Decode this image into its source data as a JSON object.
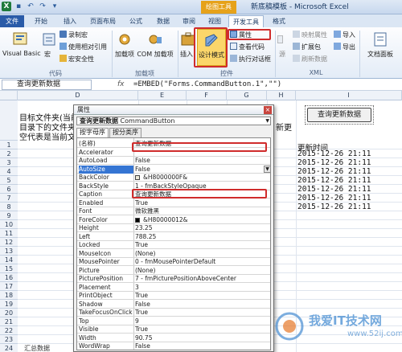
{
  "window": {
    "context_tab": "绘图工具",
    "title": "新底稿模板 - Microsoft Excel"
  },
  "tabs": [
    {
      "label": "文件"
    },
    {
      "label": "开始"
    },
    {
      "label": "插入"
    },
    {
      "label": "页面布局"
    },
    {
      "label": "公式"
    },
    {
      "label": "数据"
    },
    {
      "label": "审阅"
    },
    {
      "label": "视图"
    },
    {
      "label": "开发工具"
    },
    {
      "label": "格式"
    }
  ],
  "ribbon": {
    "code": {
      "visual_basic": "Visual Basic",
      "macro": "宏",
      "record_macro": "录制宏",
      "relative_ref": "使用相对引用",
      "macro_security": "宏安全性",
      "group_label": "代码"
    },
    "addins": {
      "addins": "加载项",
      "com_addins": "COM 加载项",
      "group_label": "加载项"
    },
    "controls": {
      "insert": "插入",
      "design_mode": "设计模式",
      "properties": "属性",
      "view_code": "查看代码",
      "run_dialog": "执行对话框",
      "group_label": "控件"
    },
    "xml": {
      "source": "源",
      "map_props": "映射属性",
      "expansion_packs": "扩展包",
      "refresh_data": "刷新数据",
      "import": "导入",
      "export": "导出",
      "group_label": "XML"
    },
    "modify": {
      "doc_panel": "文档面板"
    }
  },
  "formula_bar": {
    "name_box": "查询更新数据",
    "fx": "fx",
    "formula": "=EMBED(\"Forms.CommandButton.1\",\"\")"
  },
  "sheet": {
    "columns": [
      "D",
      "E",
      "F",
      "G",
      "H",
      "I"
    ],
    "rows": [
      "1",
      "2",
      "3",
      "4",
      "5",
      "6",
      "7",
      "8",
      "9",
      "10",
      "11",
      "12",
      "13",
      "14",
      "15",
      "16",
      "17",
      "18",
      "19",
      "20",
      "21",
      "22",
      "23",
      "24",
      "25"
    ],
    "text_lines": [
      "目标文件夹(当前",
      "目录下的文件夹",
      "空代表是当前文"
    ],
    "right_text": "新更",
    "header_update_time": "更新时间",
    "dates": [
      "2015-12-26 21:11",
      "2015-12-26 21:11",
      "2015-12-26 21:11",
      "2015-12-26 21:11",
      "2015-12-26 21:11",
      "2015-12-26 21:11",
      "2015-12-26 21:11"
    ],
    "button_label": "查询更新数据",
    "sheet_tab": "汇总数据"
  },
  "properties": {
    "title": "属性",
    "object_name": "查询更新数据",
    "object_type": "CommandButton",
    "tabs": [
      "按字母序",
      "按分类序"
    ],
    "rows": [
      {
        "name": "(名称)",
        "value": "查询更新数据"
      },
      {
        "name": "Accelerator",
        "value": ""
      },
      {
        "name": "AutoLoad",
        "value": "False"
      },
      {
        "name": "AutoSize",
        "value": "False"
      },
      {
        "name": "BackColor",
        "value": "&H8000000F&"
      },
      {
        "name": "BackStyle",
        "value": "1 - fmBackStyleOpaque"
      },
      {
        "name": "Caption",
        "value": "查询更新数据"
      },
      {
        "name": "Enabled",
        "value": "True"
      },
      {
        "name": "Font",
        "value": "微软雅黑"
      },
      {
        "name": "ForeColor",
        "value": "&H80000012&"
      },
      {
        "name": "Height",
        "value": "23.25"
      },
      {
        "name": "Left",
        "value": "788.25"
      },
      {
        "name": "Locked",
        "value": "True"
      },
      {
        "name": "MouseIcon",
        "value": "(None)"
      },
      {
        "name": "MousePointer",
        "value": "0 - fmMousePointerDefault"
      },
      {
        "name": "Picture",
        "value": "(None)"
      },
      {
        "name": "PicturePosition",
        "value": "7 - fmPicturePositionAboveCenter"
      },
      {
        "name": "Placement",
        "value": "3"
      },
      {
        "name": "PrintObject",
        "value": "True"
      },
      {
        "name": "Shadow",
        "value": "False"
      },
      {
        "name": "TakeFocusOnClick",
        "value": "True"
      },
      {
        "name": "Top",
        "value": "9"
      },
      {
        "name": "Visible",
        "value": "True"
      },
      {
        "name": "Width",
        "value": "90.75"
      },
      {
        "name": "WordWrap",
        "value": "False"
      }
    ]
  },
  "colors": {
    "highlight_red": "#d02c2c",
    "selection_blue": "#3575d3",
    "context_orange": "#e6a21a"
  },
  "watermark": {
    "text": "我爱IT技术网",
    "url": "www.52ij.com"
  }
}
